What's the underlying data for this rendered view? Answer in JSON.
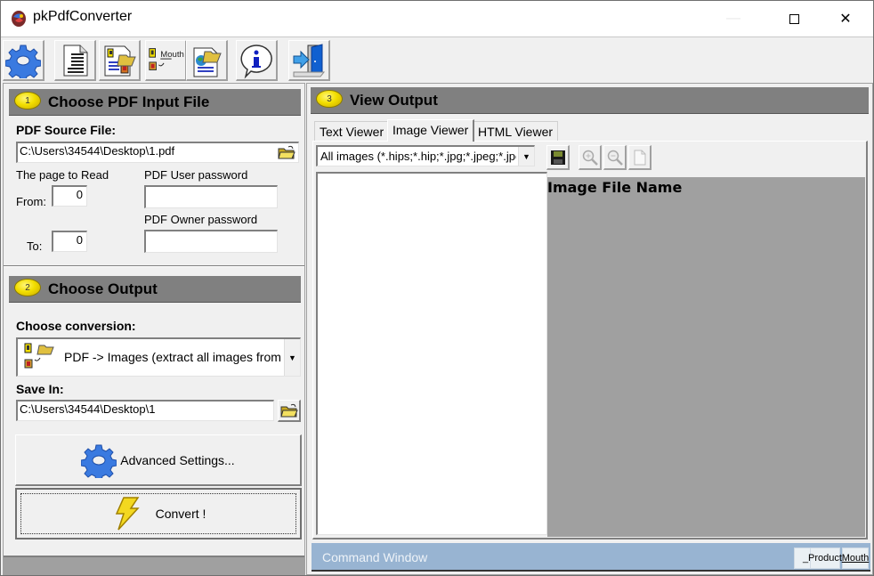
{
  "window": {
    "title": "pkPdfConverter",
    "controls": {
      "minimize": "—",
      "maximize": "",
      "close": "✕"
    }
  },
  "toolbar": {
    "buttons": [
      {
        "name": "settings",
        "icon": "gear-icon"
      },
      {
        "name": "text-document",
        "icon": "text-document-icon"
      },
      {
        "name": "open-pdf-images",
        "icon": "image-document-open-icon"
      },
      {
        "name": "extract-images",
        "icon": "extract-images-icon",
        "label": "Mouth"
      },
      {
        "name": "open-html",
        "icon": "web-document-open-icon"
      },
      {
        "name": "info",
        "icon": "info-icon"
      },
      {
        "name": "exit",
        "icon": "exit-door-icon"
      }
    ]
  },
  "section1": {
    "badge": "1",
    "title": "Choose PDF Input File",
    "source_label": "PDF Source File:",
    "source_value": "C:\\Users\\34544\\Desktop\\1.pdf",
    "page_label": "The page to Read",
    "from_label": "From:",
    "from_value": "0",
    "to_label": "To:",
    "to_value": "0",
    "user_pw_label": "PDF User password",
    "user_pw_value": "",
    "owner_pw_label": "PDF Owner  password",
    "owner_pw_value": ""
  },
  "section2": {
    "badge": "2",
    "title": "Choose Output",
    "conversion_label": "Choose conversion:",
    "conversion_value": "PDF -> Images (extract all images from PDF)",
    "save_label": "Save In:",
    "save_value": "C:\\Users\\34544\\Desktop\\1",
    "advanced_button": "Advanced Settings...",
    "convert_button": "Convert !"
  },
  "section3": {
    "badge": "3",
    "title": "View Output",
    "tabs": [
      {
        "label": "Text Viewer",
        "active": false
      },
      {
        "label": "Image Viewer",
        "active": true
      },
      {
        "label": "HTML Viewer",
        "active": false
      }
    ],
    "filter_value": "All images (*.hips;*.hip;*.jpg;*.jpeg;*.jpe;*.bmp)",
    "image_file_name_label": "Image File Name",
    "image_tools": [
      "save-icon",
      "zoom-in-icon",
      "zoom-out-icon",
      "blank-page-icon"
    ]
  },
  "command_window": {
    "label": "Command Window",
    "buttons": [
      "_",
      "Product",
      "Mouth"
    ]
  },
  "colors": {
    "section_header": "#808080",
    "badge_yellow": "#f2de00",
    "command_bar": "#98b4d2",
    "image_area": "#a0a0a0"
  }
}
